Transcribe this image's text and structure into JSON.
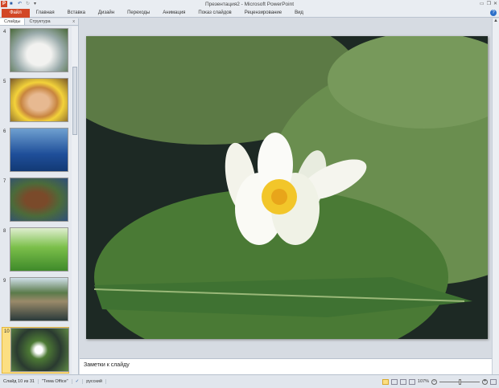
{
  "app": {
    "title": "Презентация2 - Microsoft PowerPoint",
    "logo": "P"
  },
  "ribbon": {
    "tabs": [
      "Файл",
      "Главная",
      "Вставка",
      "Дизайн",
      "Переходы",
      "Анимация",
      "Показ слайдов",
      "Рецензирование",
      "Вид"
    ]
  },
  "left_panel": {
    "tabs": [
      "Слайды",
      "Структура"
    ],
    "close": "x",
    "slides": [
      {
        "num": "4"
      },
      {
        "num": "5"
      },
      {
        "num": "6"
      },
      {
        "num": "7"
      },
      {
        "num": "8"
      },
      {
        "num": "9"
      },
      {
        "num": "10"
      }
    ]
  },
  "notes": {
    "placeholder": "Заметки к слайду"
  },
  "status": {
    "slide": "Слайд 10 из 31",
    "theme": "\"Тема Office\"",
    "language": "русский",
    "zoom": "107%"
  }
}
